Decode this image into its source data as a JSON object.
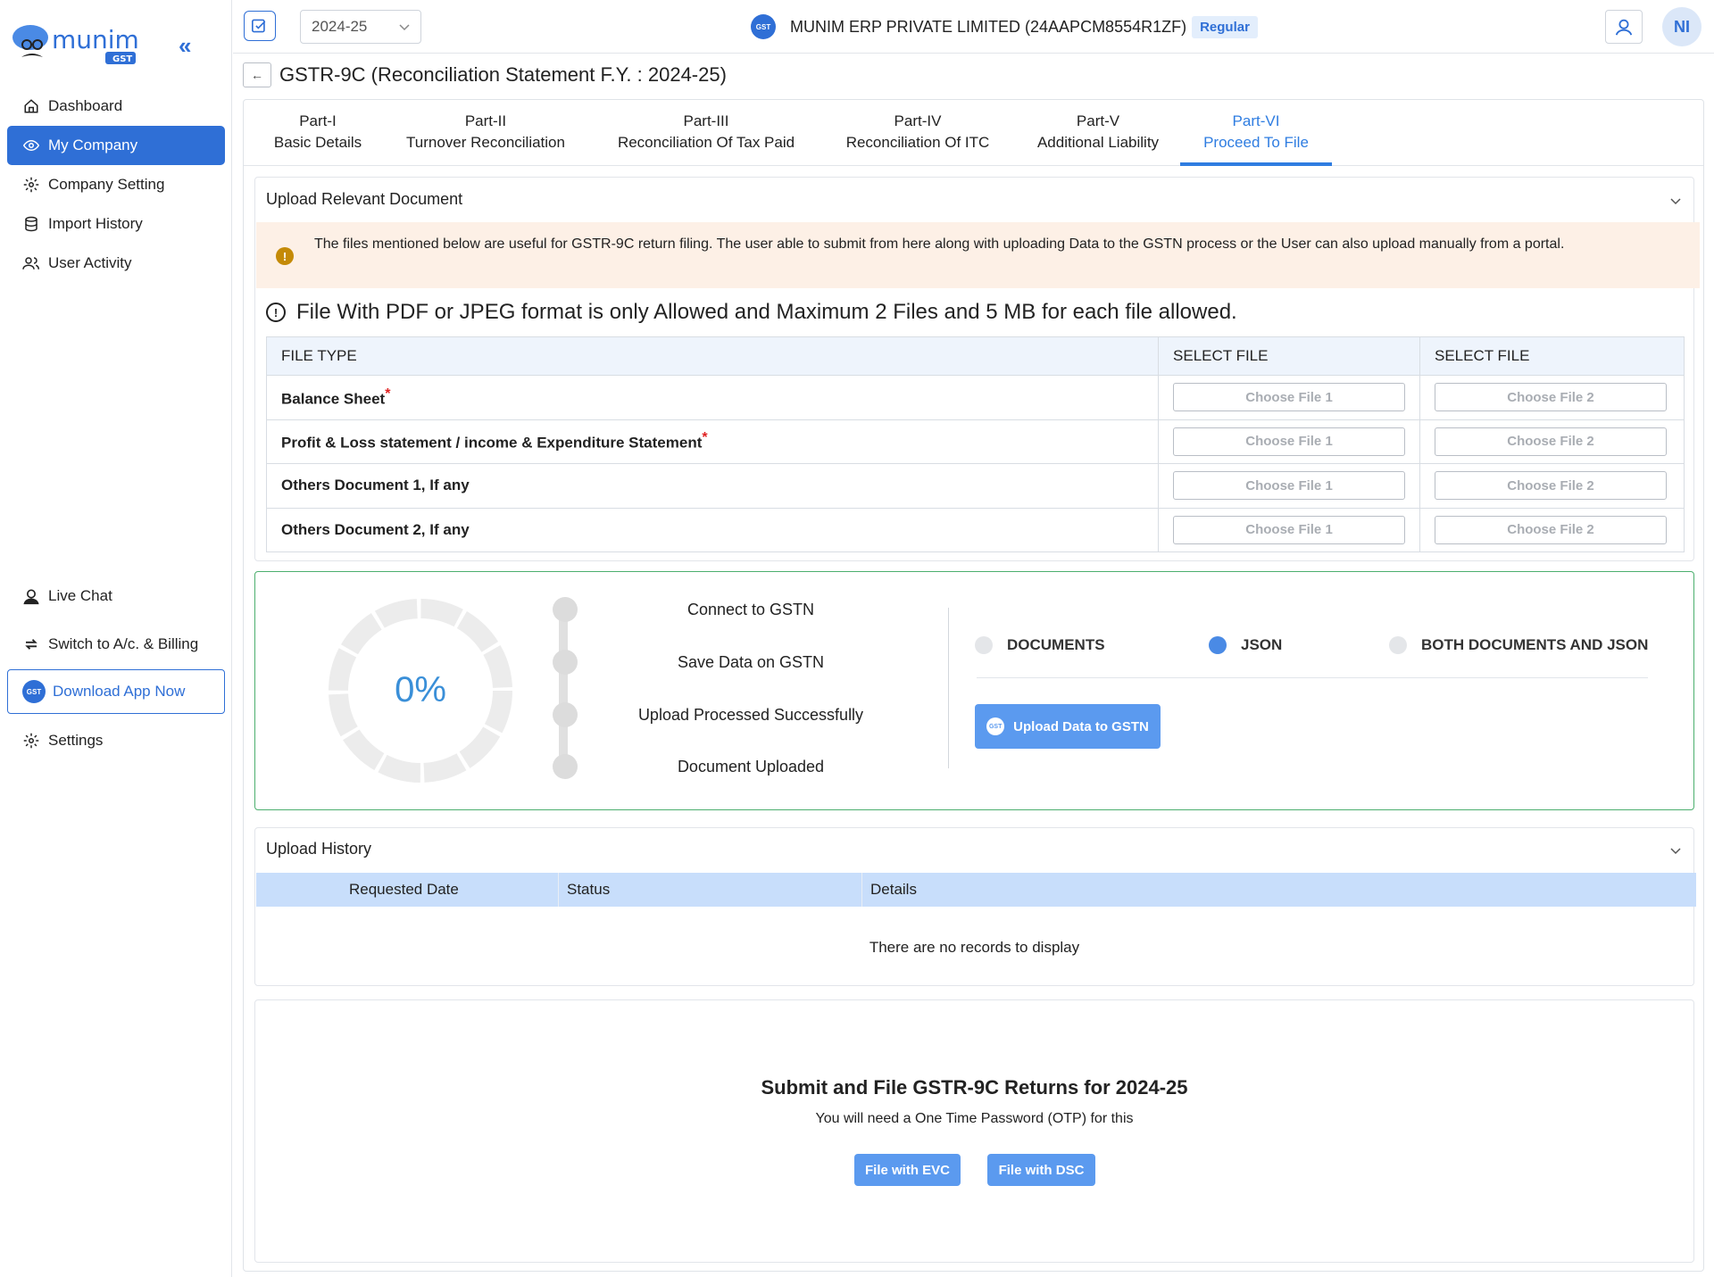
{
  "app": {
    "logo_text": "munim",
    "logo_sub": "GST"
  },
  "sidebar": {
    "items": [
      {
        "label": "Dashboard",
        "icon": "home-icon"
      },
      {
        "label": "My Company",
        "icon": "eye-icon",
        "active": true
      },
      {
        "label": "Company Setting",
        "icon": "gear-icon"
      },
      {
        "label": "Import History",
        "icon": "database-icon"
      },
      {
        "label": "User Activity",
        "icon": "users-icon"
      }
    ],
    "bottom": {
      "live_chat": "Live Chat",
      "switch": "Switch to A/c. & Billing",
      "download_app": "Download App Now",
      "settings": "Settings"
    },
    "gst_badge": "GST"
  },
  "topbar": {
    "year": "2024-25",
    "company_name": "MUNIM ERP PRIVATE LIMITED (24AAPCM8554R1ZF)",
    "company_type": "Regular",
    "avatar_initials": "NI",
    "gst_badge": "GST"
  },
  "page": {
    "title": "GSTR-9C (Reconciliation Statement F.Y. : 2024-25)"
  },
  "tabs": [
    {
      "part": "Part-I",
      "label": "Basic Details"
    },
    {
      "part": "Part-II",
      "label": "Turnover Reconciliation"
    },
    {
      "part": "Part-III",
      "label": "Reconciliation Of Tax Paid"
    },
    {
      "part": "Part-IV",
      "label": "Reconciliation Of ITC"
    },
    {
      "part": "Part-V",
      "label": "Additional Liability"
    },
    {
      "part": "Part-VI",
      "label": "Proceed To File",
      "active": true
    }
  ],
  "upload_docs": {
    "title": "Upload Relevant Document",
    "warning": "The files mentioned below are useful for GSTR-9C return filing. The user able to submit from here along with uploading Data to the GSTN process or the User can also upload manually from a portal.",
    "note": "File With PDF or JPEG format is only Allowed and Maximum 2 Files and 5 MB for each file allowed.",
    "headers": [
      "FILE TYPE",
      "SELECT FILE",
      "SELECT FILE"
    ],
    "rows": [
      {
        "name": "Balance Sheet",
        "required": true
      },
      {
        "name": "Profit & Loss statement / income & Expenditure Statement",
        "required": true
      },
      {
        "name": "Others Document 1, If any",
        "required": false
      },
      {
        "name": "Others Document 2, If any",
        "required": false
      }
    ],
    "choose_file_1": "Choose File 1",
    "choose_file_2": "Choose File 2",
    "required_mark": "*"
  },
  "progress": {
    "percent": 0,
    "percent_label": "0%",
    "steps": [
      "Connect to GSTN",
      "Save Data on GSTN",
      "Upload Processed Successfully",
      "Document Uploaded"
    ],
    "options": [
      {
        "label": "DOCUMENTS",
        "selected": false
      },
      {
        "label": "JSON",
        "selected": true
      },
      {
        "label": "BOTH DOCUMENTS AND JSON",
        "selected": false
      }
    ],
    "upload_button": "Upload Data to GSTN",
    "gst_badge": "GST"
  },
  "history": {
    "title": "Upload History",
    "columns": [
      "Requested Date",
      "Status",
      "Details"
    ],
    "empty": "There are no records to display"
  },
  "submit": {
    "title": "Submit and File GSTR-9C Returns for 2024-25",
    "subtitle": "You will need a One Time Password (OTP) for this",
    "evc": "File with EVC",
    "dsc": "File with DSC"
  },
  "colors": {
    "accent": "#2f6fd6",
    "tab_active": "#2f7de1",
    "progress_border": "#4caf6e",
    "warning_bg": "#fdf0e6"
  }
}
